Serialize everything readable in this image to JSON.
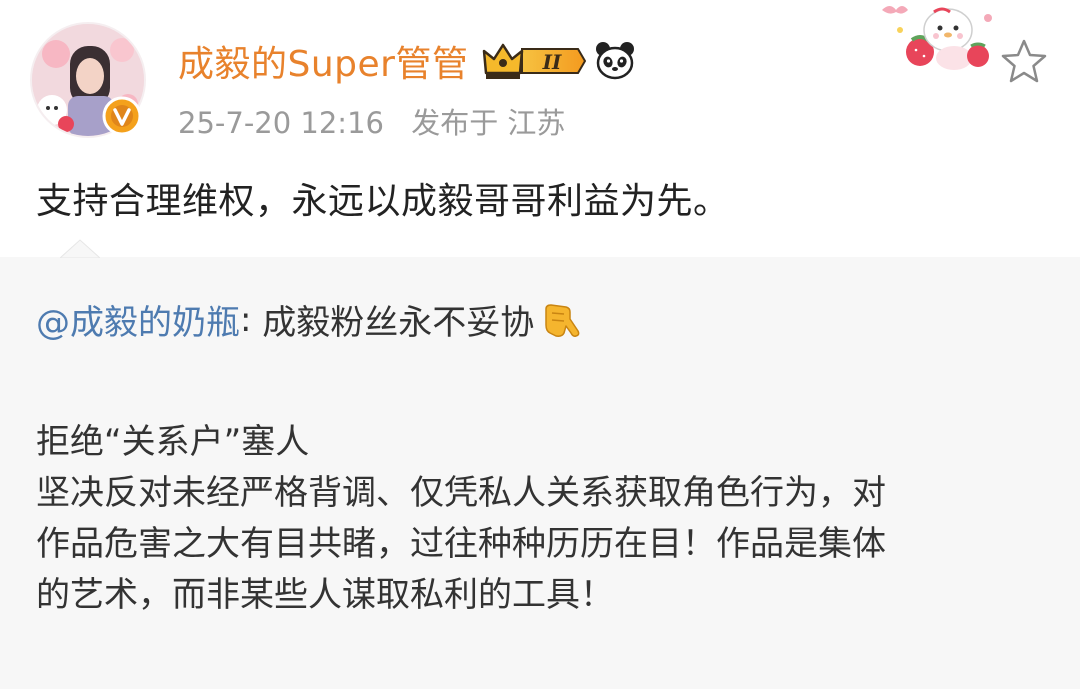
{
  "post": {
    "username": "成毅的Super管管",
    "vip_level": "II",
    "timestamp": "25-7-20 12:16",
    "location": "发布于 江苏",
    "text": "支持合理维权，永远以成毅哥哥利益为先。"
  },
  "repost": {
    "mention": "@成毅的奶瓶",
    "separator": ": ",
    "first_line": "成毅粉丝永不妥协",
    "lines": [
      "拒绝“关系户”塞人",
      "坚决反对未经严格背调、仅凭私人关系获取角色行为，对",
      "作品危害之大有目共睹，过往种种历历在目！作品是集体",
      "的艺术，而非某些人谋取私利的工具！"
    ]
  },
  "icons": {
    "verified": "verified-v-icon",
    "vip": "crown-vip-icon",
    "panda": "panda-icon",
    "star": "star-outline-icon",
    "point": "pointing-hand-emoji"
  },
  "colors": {
    "username": "#e8822c",
    "meta": "#9a9a9a",
    "mention": "#4e7bb0",
    "repost_bg": "#f7f7f7",
    "verified_badge": "#f4a11c"
  }
}
